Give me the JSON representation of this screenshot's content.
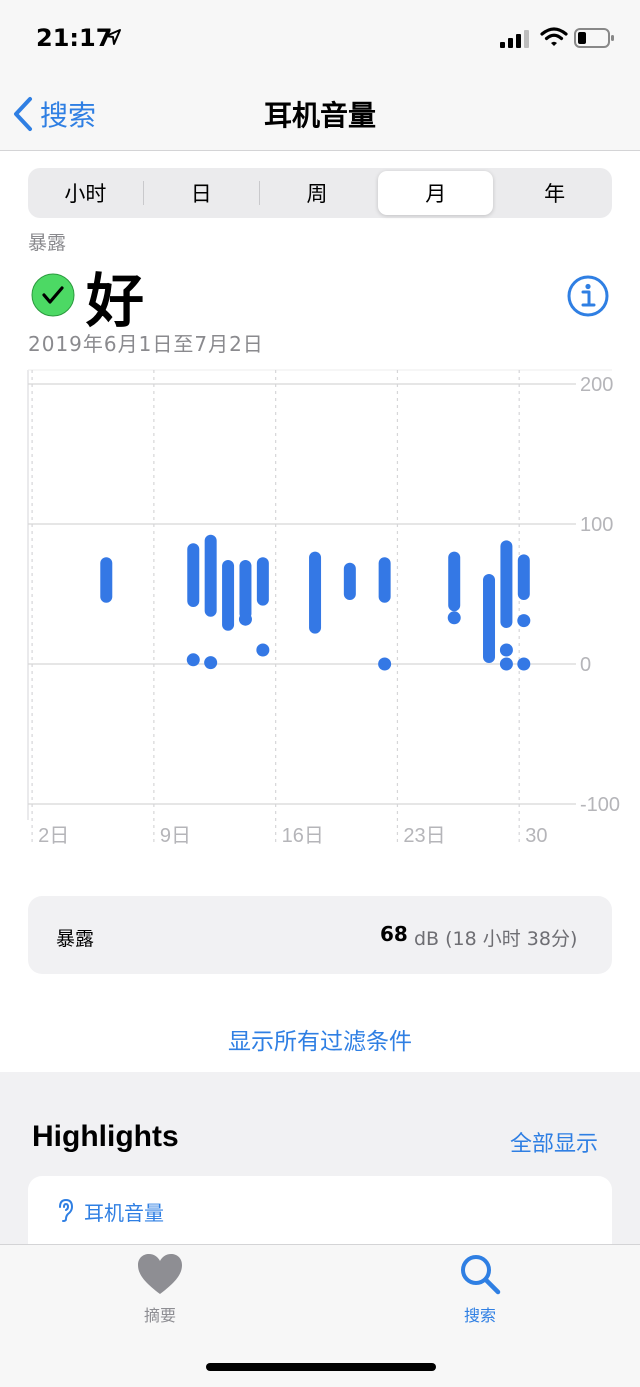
{
  "status_bar": {
    "time": "21:17"
  },
  "nav": {
    "back_label": "搜索",
    "title": "耳机音量"
  },
  "segments": [
    {
      "label": "小时",
      "selected": false
    },
    {
      "label": "日",
      "selected": false
    },
    {
      "label": "周",
      "selected": false
    },
    {
      "label": "月",
      "selected": true
    },
    {
      "label": "年",
      "selected": false
    }
  ],
  "header": {
    "exposure_label": "暴露",
    "status": "好",
    "date_range": "2019年6月1日至7月2日"
  },
  "chart_data": {
    "type": "range-bar",
    "x_ticks": [
      "2日",
      "9日",
      "16日",
      "23日",
      "30"
    ],
    "x_tick_days": [
      2,
      9,
      16,
      23,
      30
    ],
    "y_ticks": [
      "200",
      "100",
      "0",
      "-100"
    ],
    "ylim": [
      -100,
      200
    ],
    "xlim": [
      0.5,
      32
    ],
    "grid": true,
    "bars": [
      {
        "day": 5,
        "low": 48,
        "high": 72
      },
      {
        "day": 10,
        "low": 45,
        "high": 82
      },
      {
        "day": 11,
        "low": 38,
        "high": 88
      },
      {
        "day": 12,
        "low": 28,
        "high": 70
      },
      {
        "day": 13,
        "low": 36,
        "high": 70
      },
      {
        "day": 14,
        "low": 46,
        "high": 72
      },
      {
        "day": 17,
        "low": 26,
        "high": 76
      },
      {
        "day": 19,
        "low": 50,
        "high": 68
      },
      {
        "day": 21,
        "low": 48,
        "high": 72
      },
      {
        "day": 25,
        "low": 42,
        "high": 76
      },
      {
        "day": 27,
        "low": 5,
        "high": 60
      },
      {
        "day": 28,
        "low": 30,
        "high": 84
      },
      {
        "day": 29,
        "low": 50,
        "high": 74
      }
    ],
    "points": [
      {
        "day": 10,
        "value": 3
      },
      {
        "day": 11,
        "value": 1
      },
      {
        "day": 13,
        "value": 32
      },
      {
        "day": 14,
        "value": 10
      },
      {
        "day": 21,
        "value": 0
      },
      {
        "day": 25,
        "value": 33
      },
      {
        "day": 28,
        "value": 10
      },
      {
        "day": 28,
        "value": 0
      },
      {
        "day": 29,
        "value": 31
      },
      {
        "day": 29,
        "value": 0
      }
    ],
    "colors": {
      "bar": "#3478e5",
      "grid": "#d6d6d8",
      "axis_text": "#b5b5b9"
    }
  },
  "summary": {
    "label": "暴露",
    "value": "68",
    "unit": "dB (18 小时 38分)"
  },
  "filter_link": "显示所有过滤条件",
  "highlights": {
    "title": "Highlights",
    "show_all": "全部显示",
    "card_label": "耳机音量"
  },
  "tabbar": {
    "summary_label": "摘要",
    "search_label": "搜索"
  },
  "colors": {
    "accent": "#2f7fe3",
    "check_green": "#4cd964"
  }
}
